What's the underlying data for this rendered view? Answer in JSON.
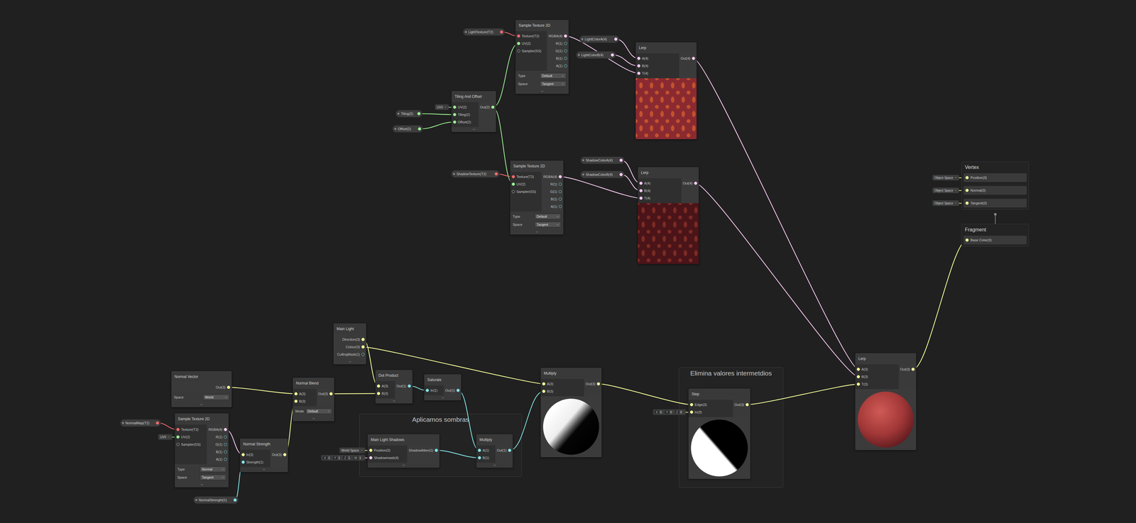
{
  "nodes": [
    {
      "title": "Sample Texture 2D",
      "inputs": [
        {
          "label": "Texture(T2)",
          "type": "t2"
        },
        {
          "label": "UV(2)",
          "type": "v2"
        },
        {
          "label": "Sampler(SS)",
          "type": "ss"
        }
      ],
      "outputs": [
        {
          "label": "RGBA(4)",
          "type": "v4"
        },
        {
          "label": "R(1)",
          "type": "v1"
        },
        {
          "label": "G(1)",
          "type": "v1"
        },
        {
          "label": "B(1)",
          "type": "v1"
        },
        {
          "label": "A(1)",
          "type": "v1"
        }
      ],
      "settings": [
        {
          "label": "Type",
          "value": "Default"
        },
        {
          "label": "Space",
          "value": "Tangent"
        }
      ]
    },
    {
      "title": "Tiling And Offset",
      "inputs": [
        {
          "label": "UV(2)",
          "type": "v2",
          "inline": {
            "kind": "dropdown",
            "value": "UV0"
          }
        },
        {
          "label": "Tiling(2)",
          "type": "v2"
        },
        {
          "label": "Offset(2)",
          "type": "v2"
        }
      ],
      "outputs": [
        {
          "label": "Out(2)",
          "type": "v2"
        }
      ]
    },
    {
      "title": "Lerp",
      "inputs": [
        {
          "label": "A(4)",
          "type": "v4"
        },
        {
          "label": "B(4)",
          "type": "v4"
        },
        {
          "label": "T(4)",
          "type": "v4"
        }
      ],
      "outputs": [
        {
          "label": "Out(4)",
          "type": "v4"
        }
      ],
      "preview": "light-texture"
    },
    {
      "title": "Sample Texture 2D",
      "inputs": [
        {
          "label": "Texture(T2)",
          "type": "t2"
        },
        {
          "label": "UV(2)",
          "type": "v2"
        },
        {
          "label": "Sampler(SS)",
          "type": "ss"
        }
      ],
      "outputs": [
        {
          "label": "RGBA(4)",
          "type": "v4"
        },
        {
          "label": "R(1)",
          "type": "v1"
        },
        {
          "label": "G(1)",
          "type": "v1"
        },
        {
          "label": "B(1)",
          "type": "v1"
        },
        {
          "label": "A(1)",
          "type": "v1"
        }
      ],
      "settings": [
        {
          "label": "Type",
          "value": "Default"
        },
        {
          "label": "Space",
          "value": "Tangent"
        }
      ]
    },
    {
      "title": "Lerp",
      "inputs": [
        {
          "label": "A(4)",
          "type": "v4"
        },
        {
          "label": "B(4)",
          "type": "v4"
        },
        {
          "label": "T(4)",
          "type": "v4"
        }
      ],
      "outputs": [
        {
          "label": "Out(4)",
          "type": "v4"
        }
      ],
      "preview": "shadow-texture"
    },
    {
      "title": "Main Light",
      "inputs": [],
      "outputs": [
        {
          "label": "Direction(3)",
          "type": "v3"
        },
        {
          "label": "Colour(3)",
          "type": "v3"
        },
        {
          "label": "CullingMask(1)",
          "type": "v1"
        }
      ]
    },
    {
      "title": "Normal Vector",
      "inputs": [],
      "outputs": [
        {
          "label": "Out(3)",
          "type": "v3"
        }
      ],
      "settings": [
        {
          "label": "Space",
          "value": "World"
        }
      ]
    },
    {
      "title": "Sample Texture 2D",
      "inputs": [
        {
          "label": "Texture(T2)",
          "type": "t2"
        },
        {
          "label": "UV(2)",
          "type": "v2",
          "inline": {
            "kind": "dropdown",
            "value": "UV0"
          }
        },
        {
          "label": "Sampler(SS)",
          "type": "ss"
        }
      ],
      "outputs": [
        {
          "label": "RGBA(4)",
          "type": "v4"
        },
        {
          "label": "R(1)",
          "type": "v1"
        },
        {
          "label": "G(1)",
          "type": "v1"
        },
        {
          "label": "B(1)",
          "type": "v1"
        },
        {
          "label": "A(1)",
          "type": "v1"
        }
      ],
      "settings": [
        {
          "label": "Type",
          "value": "Normal"
        },
        {
          "label": "Space",
          "value": "Tangent"
        }
      ]
    },
    {
      "title": "Normal Strength",
      "inputs": [
        {
          "label": "In(3)",
          "type": "v3"
        },
        {
          "label": "Strength(1)",
          "type": "v1"
        }
      ],
      "outputs": [
        {
          "label": "Out(3)",
          "type": "v3"
        }
      ]
    },
    {
      "title": "Normal Blend",
      "inputs": [
        {
          "label": "A(3)",
          "type": "v3"
        },
        {
          "label": "B(3)",
          "type": "v3"
        }
      ],
      "outputs": [
        {
          "label": "Out(3)",
          "type": "v3"
        }
      ],
      "settings": [
        {
          "label": "Mode",
          "value": "Default"
        }
      ]
    },
    {
      "title": "Dot Product",
      "inputs": [
        {
          "label": "A(3)",
          "type": "v3"
        },
        {
          "label": "B(3)",
          "type": "v3"
        }
      ],
      "outputs": [
        {
          "label": "Out(1)",
          "type": "v1"
        }
      ]
    },
    {
      "title": "Saturate",
      "inputs": [
        {
          "label": "In(1)",
          "type": "v1"
        }
      ],
      "outputs": [
        {
          "label": "Out(1)",
          "type": "v1"
        }
      ]
    },
    {
      "title": "Main Light Shadows",
      "inputs": [
        {
          "label": "Position(3)",
          "type": "v3",
          "inline": {
            "kind": "dropdown",
            "value": "World Space"
          }
        },
        {
          "label": "Shadowmask(4)",
          "type": "v4",
          "inline": {
            "kind": "vector",
            "fields": [
              {
                "axis": "X",
                "value": "1"
              },
              {
                "axis": "Y",
                "value": "1"
              },
              {
                "axis": "Z",
                "value": "1"
              },
              {
                "axis": "W",
                "value": "1"
              }
            ]
          }
        }
      ],
      "outputs": [
        {
          "label": "ShadowAtten(1)",
          "type": "v1"
        }
      ]
    },
    {
      "title": "Multiply",
      "inputs": [
        {
          "label": "A(1)",
          "type": "v1"
        },
        {
          "label": "B(1)",
          "type": "v1"
        }
      ],
      "outputs": [
        {
          "label": "Out(1)",
          "type": "v1"
        }
      ]
    },
    {
      "title": "Multiply",
      "inputs": [
        {
          "label": "A(3)",
          "type": "v3"
        },
        {
          "label": "B(3)",
          "type": "v3"
        }
      ],
      "outputs": [
        {
          "label": "Out(3)",
          "type": "v3"
        }
      ],
      "preview": "soft-shade"
    },
    {
      "title": "Step",
      "inputs": [
        {
          "label": "Edge(3)",
          "type": "v3"
        },
        {
          "label": "In(3)",
          "type": "v3",
          "inline": {
            "kind": "vector",
            "fields": [
              {
                "axis": "X",
                "value": "0"
              },
              {
                "axis": "Y",
                "value": "0"
              },
              {
                "axis": "Z",
                "value": "0"
              }
            ]
          }
        }
      ],
      "outputs": [
        {
          "label": "Out(3)",
          "type": "v3"
        }
      ],
      "preview": "hard-shade"
    },
    {
      "title": "Lerp",
      "inputs": [
        {
          "label": "A(3)",
          "type": "v3"
        },
        {
          "label": "B(3)",
          "type": "v3"
        },
        {
          "label": "T(3)",
          "type": "v3"
        }
      ],
      "outputs": [
        {
          "label": "Out(3)",
          "type": "v3"
        }
      ],
      "preview": "lit-sphere"
    }
  ],
  "properties": [
    {
      "label": "LightTexture(T2)",
      "type": "t2"
    },
    {
      "label": "LightColorA(4)",
      "type": "v4"
    },
    {
      "label": "LightColorB(4)",
      "type": "v4"
    },
    {
      "label": "Tiling(2)",
      "type": "v2"
    },
    {
      "label": "Offset(2)",
      "type": "v2"
    },
    {
      "label": "ShadowTexture(T2)",
      "type": "t2"
    },
    {
      "label": "ShadowColorA(4)",
      "type": "v4"
    },
    {
      "label": "ShadowColorB(4)",
      "type": "v4"
    },
    {
      "label": "NormalMap(T2)",
      "type": "t2"
    },
    {
      "label": "NormalStrenght(1)",
      "type": "v1"
    }
  ],
  "groups": [
    {
      "title": "Aplicamos sombras"
    },
    {
      "title": "Elimina valores intermetdios"
    }
  ],
  "stack": [
    {
      "title": "Vertex",
      "ports": [
        {
          "label": "Position(3)",
          "type": "v3",
          "space": "Object Space"
        },
        {
          "label": "Normal(3)",
          "type": "v3",
          "space": "Object Space"
        },
        {
          "label": "Tangent(3)",
          "type": "v3",
          "space": "Object Space"
        }
      ]
    },
    {
      "title": "Fragment",
      "ports": [
        {
          "label": "Base Color(3)",
          "type": "v3"
        }
      ]
    }
  ],
  "edges": [
    {
      "src": "property",
      "si": 0,
      "sp": 0,
      "dst": "node",
      "di": 0,
      "dp": 0
    },
    {
      "src": "node",
      "si": 1,
      "sp": 0,
      "dst": "node",
      "di": 0,
      "dp": 1
    },
    {
      "src": "node",
      "si": 1,
      "sp": 0,
      "dst": "node",
      "di": 3,
      "dp": 1
    },
    {
      "src": "property",
      "si": 3,
      "sp": 0,
      "dst": "node",
      "di": 1,
      "dp": 1
    },
    {
      "src": "property",
      "si": 4,
      "sp": 0,
      "dst": "node",
      "di": 1,
      "dp": 2
    },
    {
      "src": "node",
      "si": 0,
      "sp": 0,
      "dst": "node",
      "di": 2,
      "dp": 2
    },
    {
      "src": "property",
      "si": 1,
      "sp": 0,
      "dst": "node",
      "di": 2,
      "dp": 0
    },
    {
      "src": "property",
      "si": 2,
      "sp": 0,
      "dst": "node",
      "di": 2,
      "dp": 1
    },
    {
      "src": "property",
      "si": 5,
      "sp": 0,
      "dst": "node",
      "di": 3,
      "dp": 0
    },
    {
      "src": "node",
      "si": 3,
      "sp": 0,
      "dst": "node",
      "di": 4,
      "dp": 2
    },
    {
      "src": "property",
      "si": 6,
      "sp": 0,
      "dst": "node",
      "di": 4,
      "dp": 0
    },
    {
      "src": "property",
      "si": 7,
      "sp": 0,
      "dst": "node",
      "di": 4,
      "dp": 1
    },
    {
      "src": "node",
      "si": 2,
      "sp": 0,
      "dst": "node",
      "di": 16,
      "dp": 0
    },
    {
      "src": "node",
      "si": 4,
      "sp": 0,
      "dst": "node",
      "di": 16,
      "dp": 1
    },
    {
      "src": "node",
      "si": 16,
      "sp": 0,
      "dst": "stack",
      "di": 1,
      "dp": 0
    },
    {
      "src": "node",
      "si": 6,
      "sp": 0,
      "dst": "node",
      "di": 9,
      "dp": 0
    },
    {
      "src": "property",
      "si": 8,
      "sp": 0,
      "dst": "node",
      "di": 7,
      "dp": 0
    },
    {
      "src": "node",
      "si": 7,
      "sp": 0,
      "dst": "node",
      "di": 8,
      "dp": 0
    },
    {
      "src": "property",
      "si": 9,
      "sp": 0,
      "dst": "node",
      "di": 8,
      "dp": 1
    },
    {
      "src": "node",
      "si": 8,
      "sp": 0,
      "dst": "node",
      "di": 9,
      "dp": 1
    },
    {
      "src": "node",
      "si": 9,
      "sp": 0,
      "dst": "node",
      "di": 10,
      "dp": 1
    },
    {
      "src": "node",
      "si": 5,
      "sp": 0,
      "dst": "node",
      "di": 10,
      "dp": 0
    },
    {
      "src": "node",
      "si": 5,
      "sp": 1,
      "dst": "node",
      "di": 14,
      "dp": 0
    },
    {
      "src": "node",
      "si": 10,
      "sp": 0,
      "dst": "node",
      "di": 11,
      "dp": 0
    },
    {
      "src": "node",
      "si": 11,
      "sp": 0,
      "dst": "node",
      "di": 13,
      "dp": 0
    },
    {
      "src": "node",
      "si": 12,
      "sp": 0,
      "dst": "node",
      "di": 13,
      "dp": 1
    },
    {
      "src": "node",
      "si": 13,
      "sp": 0,
      "dst": "node",
      "di": 14,
      "dp": 1
    },
    {
      "src": "node",
      "si": 14,
      "sp": 0,
      "dst": "node",
      "di": 15,
      "dp": 0
    },
    {
      "src": "node",
      "si": 15,
      "sp": 0,
      "dst": "node",
      "di": 16,
      "dp": 2
    }
  ]
}
